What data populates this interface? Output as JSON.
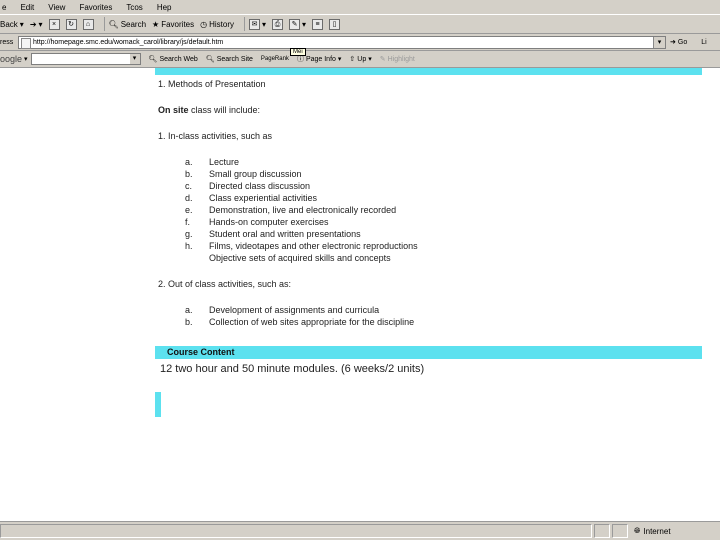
{
  "menu": [
    "e",
    "Edit",
    "View",
    "Favorites",
    "Tcos",
    "Hep"
  ],
  "toolbar": {
    "back": "Back",
    "search": "Search",
    "favorites": "Favorites",
    "history": "History"
  },
  "address": {
    "label": "ress",
    "url": "http://homepage.smc.edu/womack_carol/library/js/default.htm",
    "go": "Go",
    "links": "Li"
  },
  "google": {
    "logo": "oogle",
    "search_web": "Search Web",
    "search_site": "Search Site",
    "pagerank": "PageRank",
    "page_info": "Page Info",
    "up": "Up",
    "highlight": "Highlight"
  },
  "tooltip": "Mei",
  "page": {
    "heading": "1. Methods of Presentation",
    "onsite_bold": "On site",
    "onsite_rest": " class will include:",
    "in_class": "1. In-class activities, such as",
    "in_class_items": [
      {
        "marker": "a.",
        "text": "Lecture"
      },
      {
        "marker": "b.",
        "text": "Small group discussion"
      },
      {
        "marker": "c.",
        "text": "Directed class discussion"
      },
      {
        "marker": "d.",
        "text": "Class experiential activities"
      },
      {
        "marker": "e.",
        "text": "Demonstration, live and electronically recorded"
      },
      {
        "marker": "f.",
        "text": "Hands-on computer exercises"
      },
      {
        "marker": "g.",
        "text": "Student oral and written presentations"
      },
      {
        "marker": "h.",
        "text": "Films, videotapes and other electronic reproductions"
      },
      {
        "marker": "",
        "text": "Objective sets of acquired skills and concepts"
      }
    ],
    "out_class": "2. Out of class activities, such as:",
    "out_class_items": [
      {
        "marker": "a.",
        "text": "Development of assignments and curricula"
      },
      {
        "marker": "b.",
        "text": "Collection of web sites appropriate for the discipline"
      }
    ],
    "section_title": "Course Content",
    "modules": "12 two hour and 50 minute modules. (6 weeks/2 units)"
  },
  "status": {
    "zone": "Internet"
  }
}
